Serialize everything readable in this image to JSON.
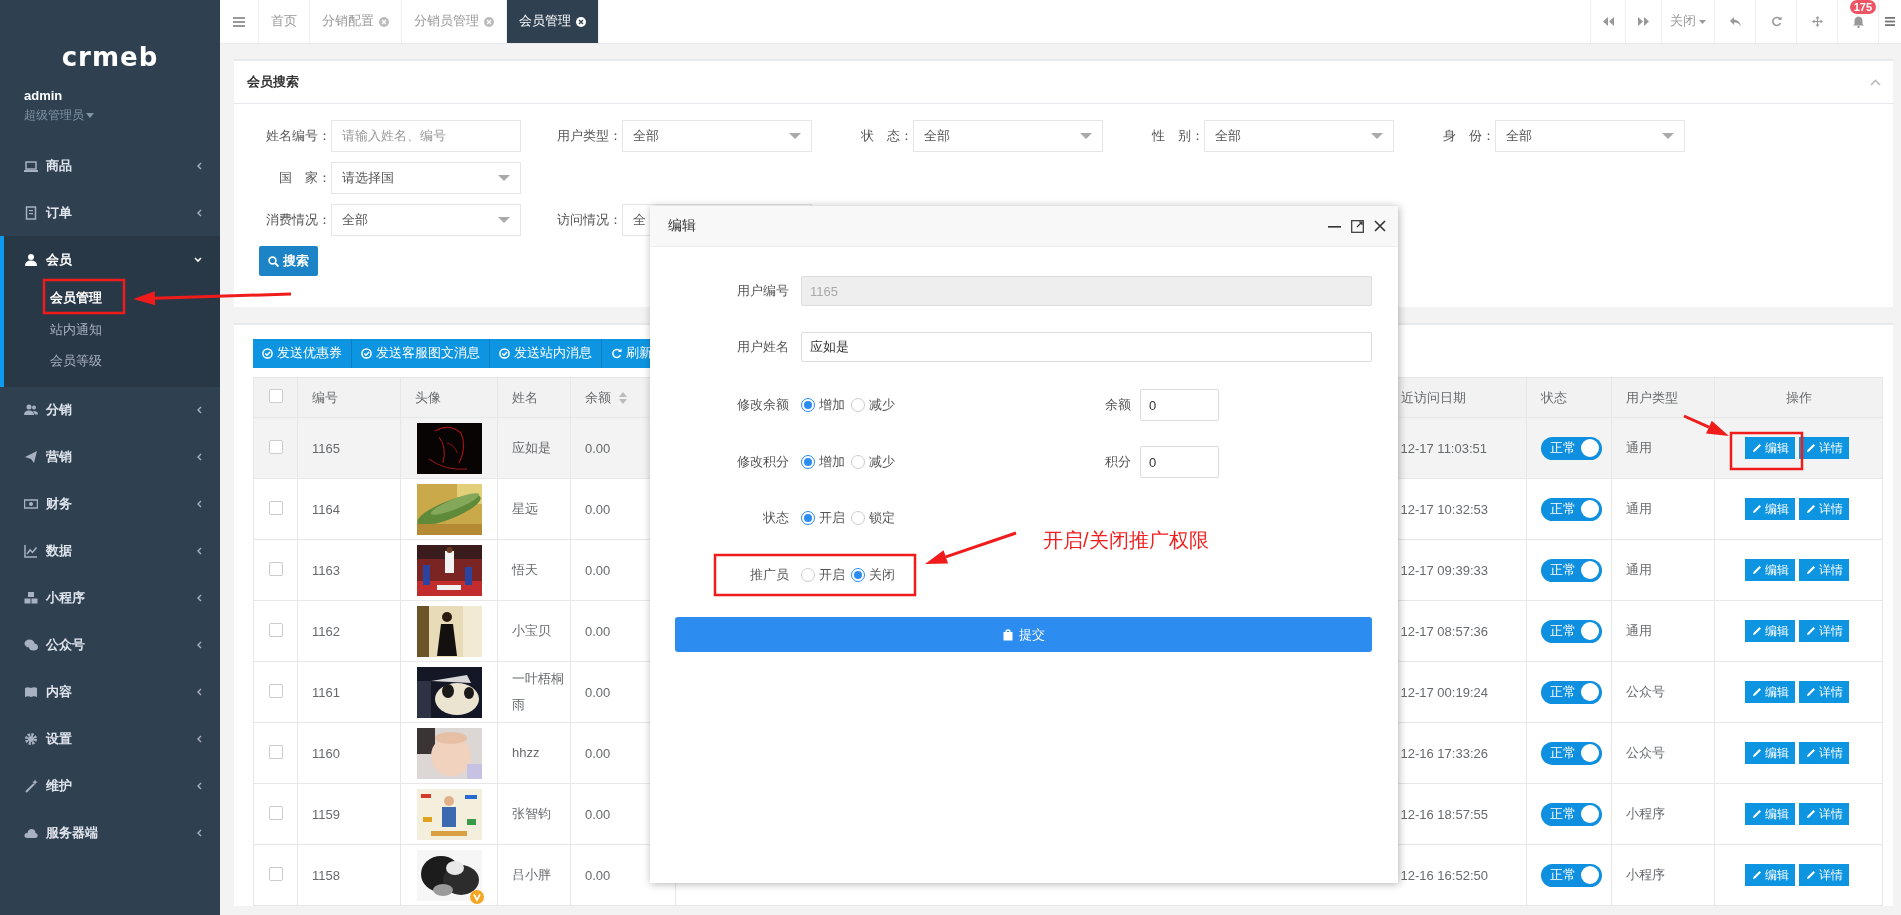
{
  "sidebar": {
    "logo": "crmeb",
    "user": {
      "name": "admin",
      "role": "超级管理员"
    },
    "menu": [
      {
        "label": "商品",
        "expanded": false
      },
      {
        "label": "订单",
        "expanded": false
      },
      {
        "label": "会员",
        "expanded": true,
        "children": [
          {
            "label": "会员管理",
            "selected": true
          },
          {
            "label": "站内通知",
            "selected": false
          },
          {
            "label": "会员等级",
            "selected": false
          }
        ]
      },
      {
        "label": "分销",
        "expanded": false
      },
      {
        "label": "营销",
        "expanded": false
      },
      {
        "label": "财务",
        "expanded": false
      },
      {
        "label": "数据",
        "expanded": false
      },
      {
        "label": "小程序",
        "expanded": false
      },
      {
        "label": "公众号",
        "expanded": false
      },
      {
        "label": "内容",
        "expanded": false
      },
      {
        "label": "设置",
        "expanded": false
      },
      {
        "label": "维护",
        "expanded": false
      },
      {
        "label": "服务器端",
        "expanded": false
      }
    ]
  },
  "topbar": {
    "tabs": [
      {
        "label": "首页",
        "closable": false,
        "selected": false
      },
      {
        "label": "分销配置",
        "closable": true,
        "selected": false
      },
      {
        "label": "分销员管理",
        "closable": true,
        "selected": false
      },
      {
        "label": "会员管理",
        "closable": true,
        "selected": true
      }
    ],
    "close_menu": "关闭",
    "notification_count": "175"
  },
  "search": {
    "title": "会员搜索",
    "rows": [
      [
        {
          "label": "姓名编号：",
          "kind": "text",
          "placeholder": "请输入姓名、编号"
        },
        {
          "label": "用户类型：",
          "kind": "select",
          "value": "全部"
        },
        {
          "label": "状　态：",
          "kind": "select",
          "value": "全部"
        },
        {
          "label": "性　别：",
          "kind": "select",
          "value": "全部"
        },
        {
          "label": "身　份：",
          "kind": "select",
          "value": "全部"
        }
      ],
      [
        {
          "label": "国　家：",
          "kind": "select",
          "value": "请选择国"
        }
      ],
      [
        {
          "label": "消费情况：",
          "kind": "select",
          "value": "全部"
        },
        {
          "label": "访问情况：",
          "kind": "select",
          "value": "全"
        }
      ]
    ],
    "button": "搜索"
  },
  "toolbar": [
    "发送优惠券",
    "发送客服图文消息",
    "发送站内消息",
    "刷新"
  ],
  "table": {
    "select_all_checked": false,
    "columns": [
      "编号",
      "头像",
      "姓名",
      "余额",
      "近访问日期",
      "状态",
      "用户类型",
      "操作"
    ],
    "rows": [
      {
        "id": "1165",
        "name": "应如是",
        "balance": "0.00",
        "last_visit": "12-17 11:03:51",
        "status": "正常",
        "status_on": true,
        "user_type": "通用",
        "checked": false,
        "highlighted": true,
        "verified": false,
        "actions": [
          "编辑",
          "详情"
        ]
      },
      {
        "id": "1164",
        "name": "星远",
        "balance": "0.00",
        "last_visit": "12-17 10:32:53",
        "status": "正常",
        "status_on": true,
        "user_type": "通用",
        "checked": false,
        "highlighted": false,
        "verified": false,
        "actions": [
          "编辑",
          "详情"
        ]
      },
      {
        "id": "1163",
        "name": "悟天",
        "balance": "0.00",
        "last_visit": "12-17 09:39:33",
        "status": "正常",
        "status_on": true,
        "user_type": "通用",
        "checked": false,
        "highlighted": false,
        "verified": false,
        "actions": [
          "编辑",
          "详情"
        ]
      },
      {
        "id": "1162",
        "name": "小宝贝",
        "balance": "0.00",
        "last_visit": "12-17 08:57:36",
        "status": "正常",
        "status_on": true,
        "user_type": "通用",
        "checked": false,
        "highlighted": false,
        "verified": false,
        "actions": [
          "编辑",
          "详情"
        ]
      },
      {
        "id": "1161",
        "name": "一叶梧桐雨",
        "balance": "0.00",
        "last_visit": "12-17 00:19:24",
        "status": "正常",
        "status_on": true,
        "user_type": "公众号",
        "checked": false,
        "highlighted": false,
        "verified": false,
        "actions": [
          "编辑",
          "详情"
        ]
      },
      {
        "id": "1160",
        "name": "hhzz",
        "balance": "0.00",
        "last_visit": "12-16 17:33:26",
        "status": "正常",
        "status_on": true,
        "user_type": "公众号",
        "checked": false,
        "highlighted": false,
        "verified": false,
        "actions": [
          "编辑",
          "详情"
        ]
      },
      {
        "id": "1159",
        "name": "张智钧",
        "balance": "0.00",
        "last_visit": "12-16 18:57:55",
        "status": "正常",
        "status_on": true,
        "user_type": "小程序",
        "checked": false,
        "highlighted": false,
        "verified": false,
        "actions": [
          "编辑",
          "详情"
        ]
      },
      {
        "id": "1158",
        "name": "吕小胖",
        "balance": "0.00",
        "last_visit": "12-16 16:52:50",
        "status": "正常",
        "status_on": true,
        "user_type": "小程序",
        "checked": false,
        "highlighted": false,
        "verified": true,
        "actions": [
          "编辑",
          "详情"
        ]
      }
    ]
  },
  "modal": {
    "title": "编辑",
    "fields": [
      {
        "label": "用户编号",
        "kind": "text",
        "value": "1165",
        "disabled": true
      },
      {
        "label": "用户姓名",
        "kind": "text",
        "value": "应如是",
        "disabled": false
      },
      {
        "label": "修改余额",
        "kind": "radio",
        "options": [
          {
            "label": "增加",
            "selected": true
          },
          {
            "label": "减少",
            "selected": false
          }
        ],
        "side_label": "余额",
        "side_value": "0"
      },
      {
        "label": "修改积分",
        "kind": "radio",
        "options": [
          {
            "label": "增加",
            "selected": true
          },
          {
            "label": "减少",
            "selected": false
          }
        ],
        "side_label": "积分",
        "side_value": "0"
      },
      {
        "label": "状态",
        "kind": "radio",
        "options": [
          {
            "label": "开启",
            "selected": true
          },
          {
            "label": "锁定",
            "selected": false
          }
        ]
      },
      {
        "label": "推广员",
        "kind": "radio",
        "options": [
          {
            "label": "开启",
            "selected": false
          },
          {
            "label": "关闭",
            "selected": true
          }
        ]
      }
    ],
    "submit": "提交",
    "annotation": "开启/关闭推广权限"
  }
}
